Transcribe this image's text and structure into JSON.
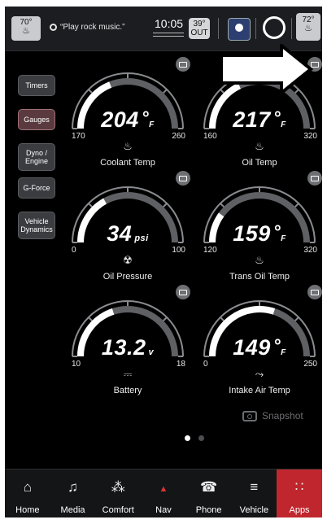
{
  "status_bar": {
    "driver_temp": "70°",
    "voice_text": "“Play rock music.”",
    "clock": "10:05",
    "outside_temp": "39°",
    "outside_label": "OUT",
    "passenger_temp": "72°"
  },
  "side_menu": [
    {
      "label": "Timers",
      "active": false
    },
    {
      "label": "Gauges",
      "active": true
    },
    {
      "label": "Dyno / Engine",
      "active": false
    },
    {
      "label": "G-Force",
      "active": false
    },
    {
      "label": "Vehicle Dynamics",
      "active": false
    }
  ],
  "gauges": [
    {
      "label": "Coolant Temp",
      "value": "204",
      "unit": "°",
      "sub": "F",
      "min": "170",
      "max": "260",
      "fraction": 0.38,
      "icon": "coolant-temp-icon"
    },
    {
      "label": "Oil Temp",
      "value": "217",
      "unit": "°",
      "sub": "F",
      "min": "160",
      "max": "320",
      "fraction": 0.36,
      "icon": "oil-temp-icon"
    },
    {
      "label": "Oil Pressure",
      "value": "34",
      "unit": "psi",
      "sub": "",
      "min": "0",
      "max": "100",
      "fraction": 0.34,
      "icon": "oil-pressure-icon"
    },
    {
      "label": "Trans Oil Temp",
      "value": "159",
      "unit": "°",
      "sub": "F",
      "min": "120",
      "max": "320",
      "fraction": 0.2,
      "icon": "trans-oil-temp-icon"
    },
    {
      "label": "Battery",
      "value": "13.2",
      "unit": "v",
      "sub": "",
      "min": "10",
      "max": "18",
      "fraction": 0.4,
      "icon": "battery-icon"
    },
    {
      "label": "Intake Air Temp",
      "value": "149",
      "unit": "°",
      "sub": "F",
      "min": "0",
      "max": "250",
      "fraction": 0.6,
      "icon": "intake-air-temp-icon"
    }
  ],
  "snapshot_label": "Snapshot",
  "pagination": {
    "current": 1,
    "total": 2
  },
  "dock": [
    {
      "label": "Home",
      "icon": "home-icon",
      "active": false
    },
    {
      "label": "Media",
      "icon": "music-note-icon",
      "active": false
    },
    {
      "label": "Comfort",
      "icon": "comfort-seat-icon",
      "active": false
    },
    {
      "label": "Nav",
      "icon": "compass-icon",
      "active": false
    },
    {
      "label": "Phone",
      "icon": "phone-icon",
      "active": false
    },
    {
      "label": "Vehicle",
      "icon": "car-icon",
      "active": false
    },
    {
      "label": "Apps",
      "icon": "apps-grid-icon",
      "active": true
    }
  ],
  "colors": {
    "accent": "#c0262d",
    "gauge_fill": "#ffffff",
    "gauge_track": "#5e6064"
  }
}
